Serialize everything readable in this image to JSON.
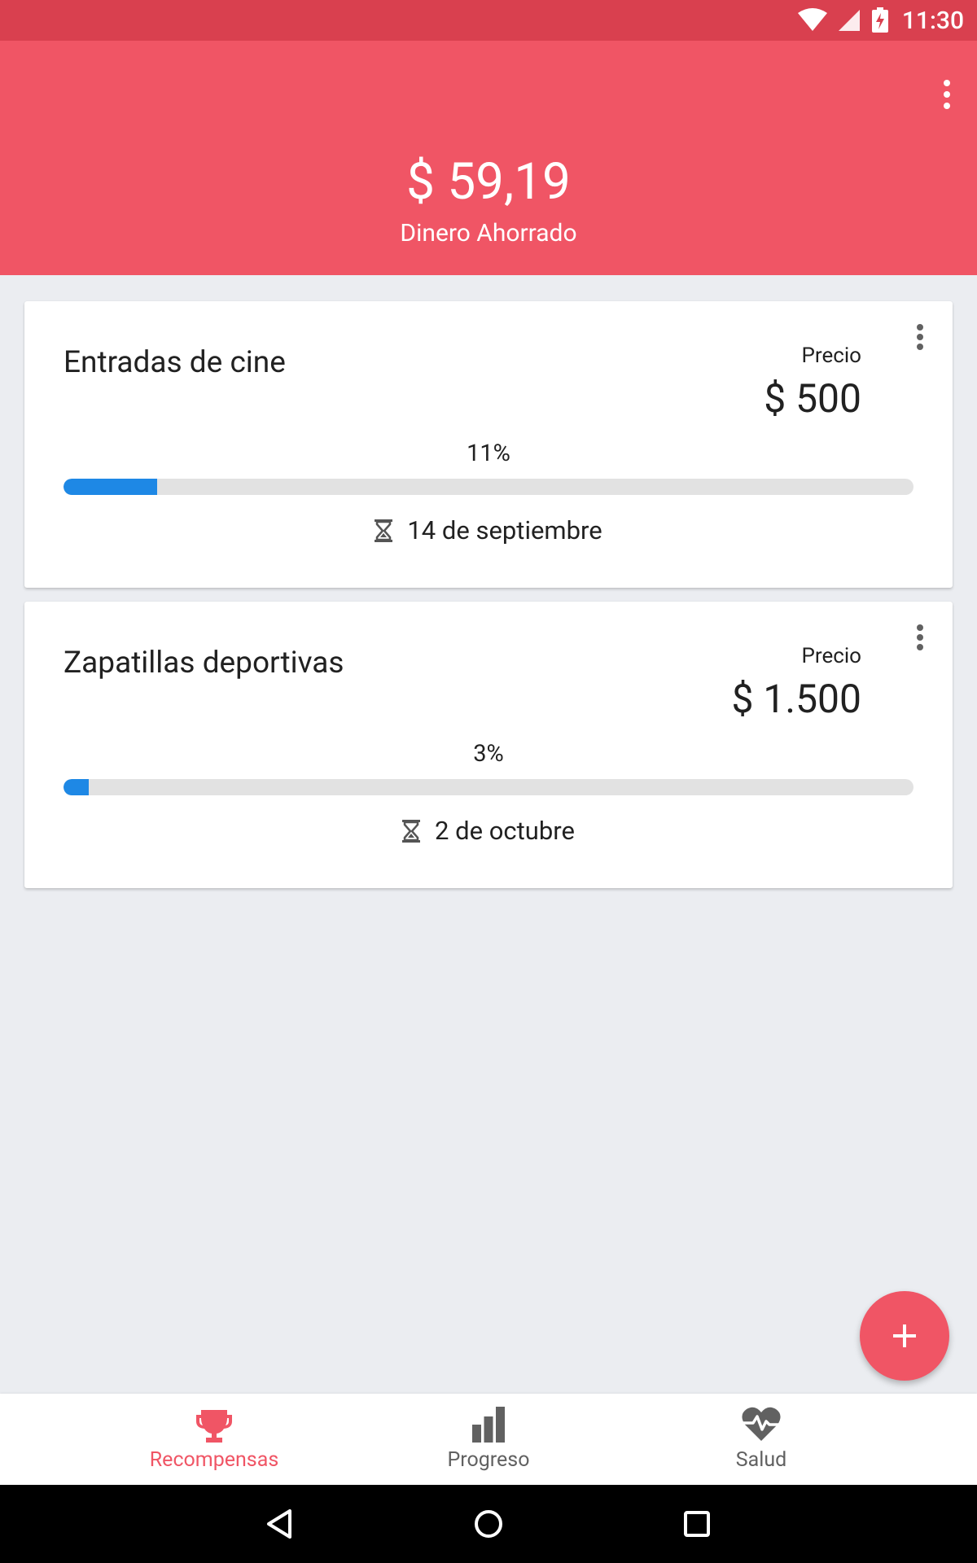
{
  "status_bar": {
    "time": "11:30"
  },
  "header": {
    "saved_amount": "$ 59,19",
    "saved_label": "Dinero Ahorrado"
  },
  "rewards": [
    {
      "title": "Entradas de cine",
      "price_label": "Precio",
      "price": "$ 500",
      "progress_label": "11%",
      "progress": 0.11,
      "deadline": "14 de septiembre"
    },
    {
      "title": "Zapatillas deportivas",
      "price_label": "Precio",
      "price": "$ 1.500",
      "progress_label": "3%",
      "progress": 0.03,
      "deadline": "2 de octubre"
    }
  ],
  "bottom_nav": [
    {
      "label": "Recompensas",
      "icon": "trophy-icon",
      "active": true
    },
    {
      "label": "Progreso",
      "icon": "bar-chart-icon",
      "active": false
    },
    {
      "label": "Salud",
      "icon": "heart-pulse-icon",
      "active": false
    }
  ],
  "colors": {
    "primary": "#f05565",
    "status_bar": "#d9404f",
    "progress": "#1e88e5",
    "background": "#ebedf1"
  }
}
